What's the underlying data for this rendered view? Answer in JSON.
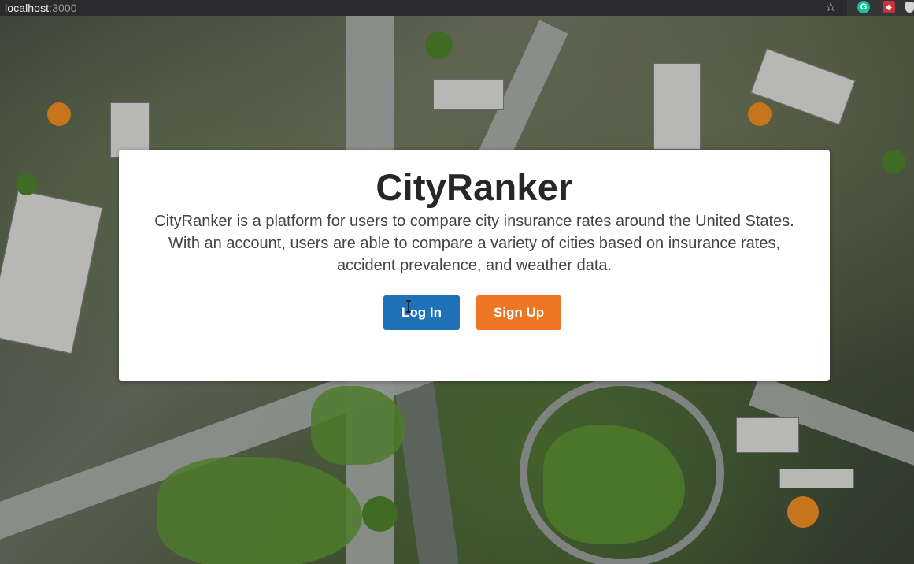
{
  "browser": {
    "url_host": "localhost",
    "url_port": ":3000",
    "extension_g": "G"
  },
  "card": {
    "title": "CityRanker",
    "description_line1": "CityRanker is a platform for users to compare city insurance rates around the United States.",
    "description_line2": "With an account, users are able to compare a variety of cities based on insurance rates,",
    "description_line3": "accident prevalence, and weather data."
  },
  "buttons": {
    "login_label": "Log In",
    "signup_label": "Sign Up"
  },
  "colors": {
    "login": "#1f72b8",
    "signup": "#ee7622"
  },
  "icons": {
    "bookmark": "star-icon",
    "grammarly": "grammarly-icon",
    "extension": "extension-icon",
    "cursor": "text-cursor-icon"
  }
}
